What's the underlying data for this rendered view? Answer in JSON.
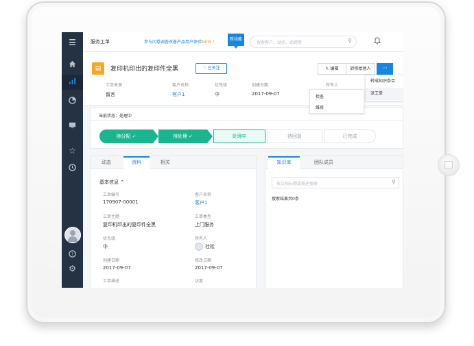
{
  "topbar": {
    "title": "服务工单",
    "notice": "参与问卷调查改善产品用户体验",
    "notice_new": "NEW !",
    "badge": "新功能",
    "search_placeholder": "搜索客户、动态、话题等"
  },
  "ticket": {
    "title": "复印机印出的复印件全黑",
    "follow_label": "已关注",
    "edit_label": "编辑",
    "transfer_label": "转移给他人",
    "more_label": "···",
    "meta": [
      {
        "label": "工单来源",
        "value": "留言"
      },
      {
        "label": "客户名称",
        "value": "客户1"
      },
      {
        "label": "优先级",
        "value": "中"
      },
      {
        "label": "创建日期",
        "value": "2017-09-07"
      },
      {
        "label": "所有人",
        "value": ""
      }
    ]
  },
  "dropdown": {
    "items": [
      "转成知识条目",
      "派工单"
    ],
    "submenu": [
      "检查",
      "维修"
    ]
  },
  "status": {
    "label": "当前状态：处理中",
    "steps": [
      "待分配",
      "待处理",
      "处理中",
      "待回复",
      "已完成"
    ]
  },
  "left_panel": {
    "tabs": [
      "动态",
      "资料",
      "相关"
    ],
    "section_title": "基本信息",
    "fields": [
      {
        "label": "工单编号",
        "value": "170907-00001"
      },
      {
        "label": "客户名称",
        "value": "客户1"
      },
      {
        "label": "工单主题",
        "value": "复印机印出的复印件全黑"
      },
      {
        "label": "工单类型",
        "value": "上门服务"
      },
      {
        "label": "优先级",
        "value": "中"
      },
      {
        "label": "所有人",
        "value": "杜松"
      },
      {
        "label": "创建日期",
        "value": "2017-09-07"
      },
      {
        "label": "修改日期",
        "value": "2017-09-07"
      },
      {
        "label": "工单描述",
        "value": ""
      },
      {
        "label": "访客",
        "value": ""
      }
    ]
  },
  "right_panel": {
    "tabs": [
      "知识库",
      "团队成员"
    ],
    "search_placeholder": "按文档标题或描述搜索",
    "result_count": "搜索结果共0条"
  },
  "colors": {
    "accent": "#1a85e0",
    "success": "#19b58e",
    "sidebar": "#243243",
    "ticket_icon": "#f5a623"
  },
  "icons": {
    "sidebar": [
      "menu-icon",
      "home-icon",
      "bar-chart-icon",
      "pie-chart-icon",
      "monitor-icon",
      "star-icon",
      "clock-icon",
      "help-icon",
      "settings-icon"
    ]
  }
}
